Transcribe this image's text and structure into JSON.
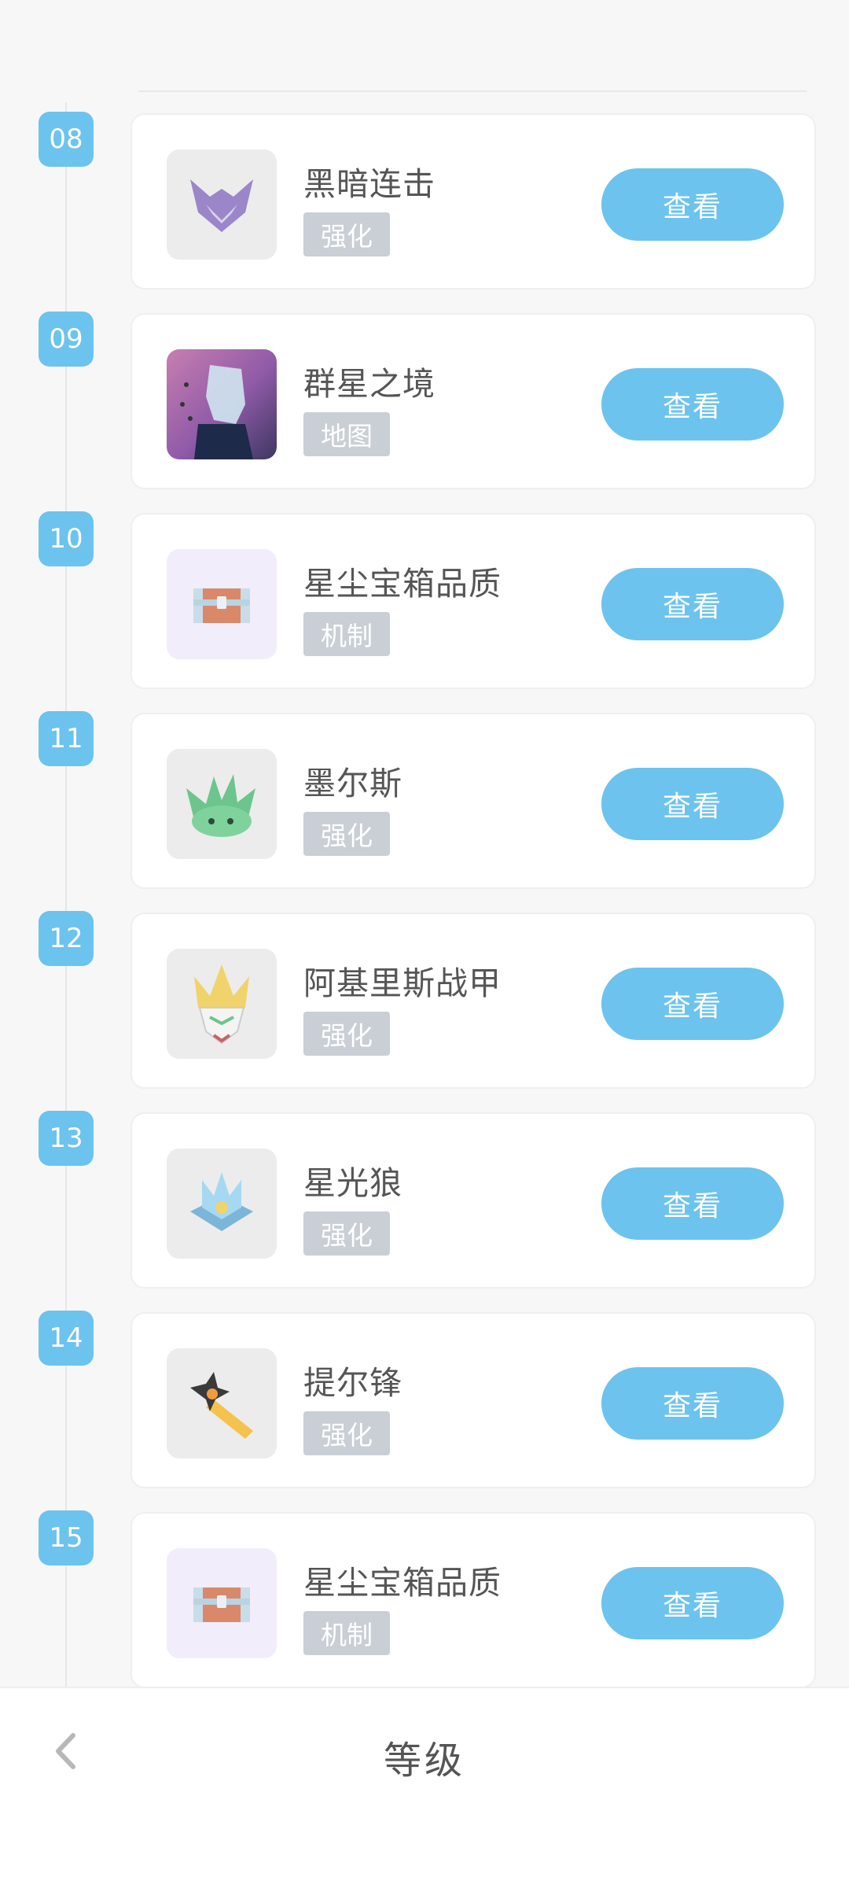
{
  "view_label": "查看",
  "footer": {
    "title": "等级"
  },
  "rows": [
    {
      "num": "08",
      "title": "黑暗连击",
      "tag": "强化",
      "icon": "dark-wings-icon"
    },
    {
      "num": "09",
      "title": "群星之境",
      "tag": "地图",
      "icon": "star-realm-map-icon"
    },
    {
      "num": "10",
      "title": "星尘宝箱品质",
      "tag": "机制",
      "icon": "treasure-chest-icon"
    },
    {
      "num": "11",
      "title": "墨尔斯",
      "tag": "强化",
      "icon": "green-creature-icon"
    },
    {
      "num": "12",
      "title": "阿基里斯战甲",
      "tag": "强化",
      "icon": "armor-helmet-icon"
    },
    {
      "num": "13",
      "title": "星光狼",
      "tag": "强化",
      "icon": "star-wolf-icon"
    },
    {
      "num": "14",
      "title": "提尔锋",
      "tag": "强化",
      "icon": "sword-icon"
    },
    {
      "num": "15",
      "title": "星尘宝箱品质",
      "tag": "机制",
      "icon": "treasure-chest-icon"
    }
  ],
  "colors": {
    "accent": "#6cc3ee",
    "tag": "#c9cfd5",
    "text": "#555555"
  }
}
